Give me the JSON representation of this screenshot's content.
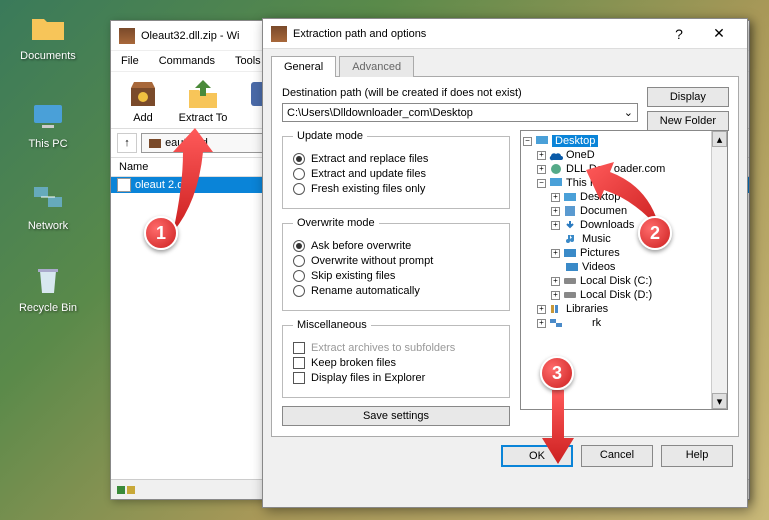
{
  "desktop": {
    "documents": "Documents",
    "thispc": "This PC",
    "network": "Network",
    "recycle": "Recycle Bin"
  },
  "winrar": {
    "title": "Oleaut32.dll.zip - Wi",
    "menu": {
      "file": "File",
      "commands": "Commands",
      "tools": "Tools"
    },
    "toolbar": {
      "add": "Add",
      "extractto": "Extract To"
    },
    "archiveName": "eaut32.d",
    "col_name": "Name",
    "fileRow": "oleaut 2.dll"
  },
  "dialog": {
    "title": "Extraction path and options",
    "help_sym": "?",
    "close_sym": "✕",
    "tabs": {
      "general": "General",
      "advanced": "Advanced"
    },
    "dest_label": "Destination path (will be created if does not exist)",
    "dest_path": "C:\\Users\\Dlldownloader_com\\Desktop",
    "btn_display": "Display",
    "btn_newfolder": "New Folder",
    "update": {
      "legend": "Update mode",
      "opt1": "Extract and replace files",
      "opt2": "Extract and update files",
      "opt3": "Fresh existing files only"
    },
    "overwrite": {
      "legend": "Overwrite mode",
      "opt1": "Ask before overwrite",
      "opt2": "Overwrite without prompt",
      "opt3": "Skip existing files",
      "opt4": "Rename automatically"
    },
    "misc": {
      "legend": "Miscellaneous",
      "opt1": "Extract archives to subfolders",
      "opt2": "Keep broken files",
      "opt3": "Display files in Explorer"
    },
    "save_settings": "Save settings",
    "tree": {
      "desktop": "Desktop",
      "onedrive": "OneD",
      "dll": "DLL Dow    oader.com",
      "thispc": "This PC",
      "t_desktop": "Desktop",
      "t_documents": "Documen",
      "t_downloads": "Downloads",
      "t_music": "Music",
      "t_pictures": "Pictures",
      "t_videos": "Videos",
      "t_localc": "Local Disk (C:)",
      "t_locald": "Local Disk (D:)",
      "libraries": "Libraries",
      "network": "rk"
    },
    "btn_ok": "OK",
    "btn_cancel": "Cancel",
    "btn_help": "Help"
  },
  "anno": {
    "one": "1",
    "two": "2",
    "three": "3"
  }
}
